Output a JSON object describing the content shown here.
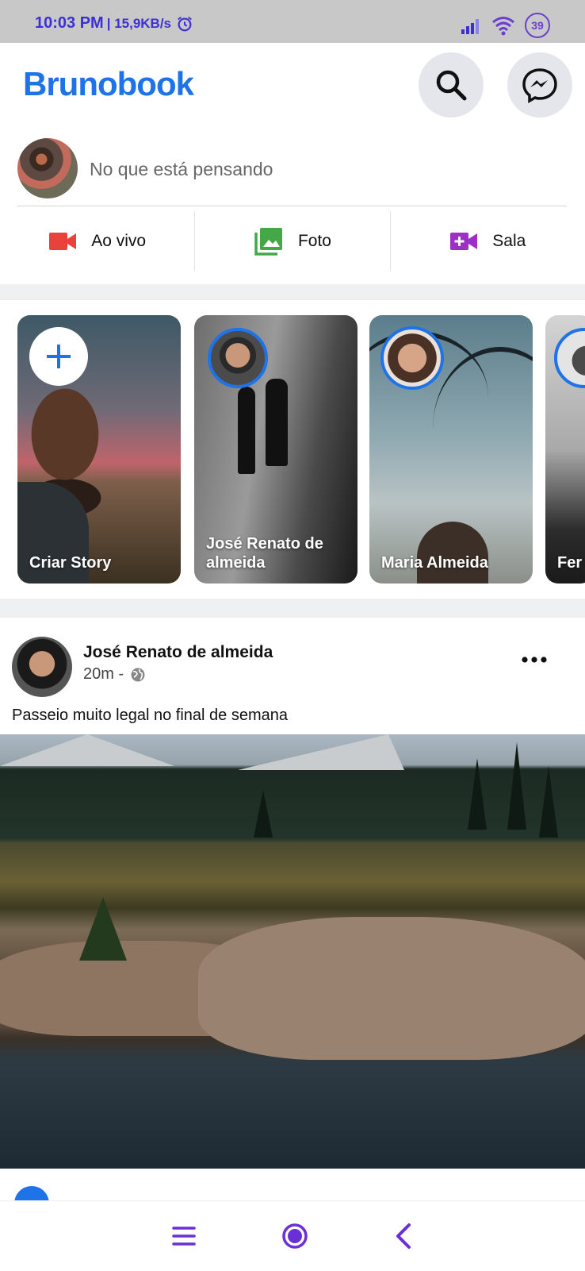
{
  "status_bar": {
    "time": "10:03 PM",
    "speed": "| 15,9KB/s",
    "battery": "39",
    "icons": [
      "alarm-icon",
      "signal-icon",
      "wifi-icon",
      "battery-icon"
    ],
    "accent": "#3d2fd6"
  },
  "header": {
    "brand": "Brunobook",
    "brand_color": "#1f73e8",
    "buttons": [
      "search-icon",
      "messenger-icon"
    ]
  },
  "composer": {
    "placeholder": "No que está pensando",
    "actions": [
      {
        "label": "Ao vivo",
        "icon": "video-camera-icon",
        "color": "#e8423b"
      },
      {
        "label": "Foto",
        "icon": "photo-gallery-icon",
        "color": "#45a848"
      },
      {
        "label": "Sala",
        "icon": "video-add-icon",
        "color": "#9b2fc8"
      }
    ]
  },
  "stories": [
    {
      "label": "Criar Story"
    },
    {
      "label": "José Renato de almeida"
    },
    {
      "label": "Maria Almeida"
    },
    {
      "label": "Fer albu"
    }
  ],
  "post": {
    "author": "José Renato de almeida",
    "time": "20m -",
    "text": "Passeio muito legal no final de semana",
    "icons": [
      "globe-icon",
      "more-options-icon"
    ]
  },
  "nav": {
    "icons": [
      "menu-icon",
      "home-circle-icon",
      "back-icon"
    ],
    "color": "#6a30d6"
  }
}
